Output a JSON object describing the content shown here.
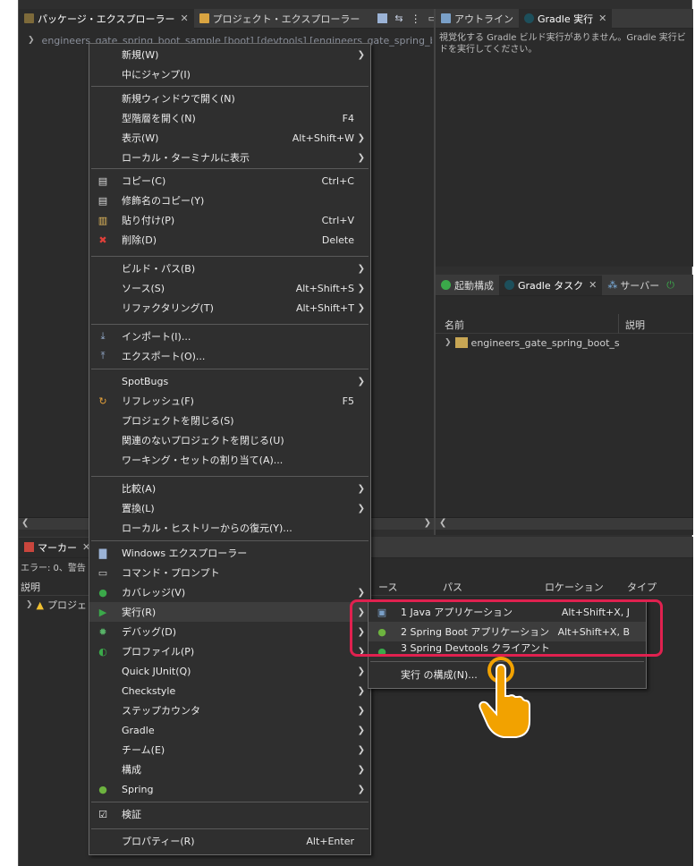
{
  "left_tabs": {
    "package_explorer": "パッケージ・エクスプローラー",
    "project_explorer": "プロジェクト・エクスプローラー"
  },
  "right_tabs": {
    "outline": "アウトライン",
    "gradle_run": "Gradle 実行"
  },
  "gradle_run_message": "視覚化する Gradle ビルド実行がありません。Gradle 実行ビドを実行してください。",
  "gradle_run_message_line1": "視覚化する Gradle ビルド実行がありません。Gradle 実行ビ",
  "gradle_run_message_line2": "ドを実行してください。",
  "project_path": "engineers_gate_spring_boot_sample [boot] [devtools] [engineers_gate_spring_bo",
  "mid_tabs": {
    "launch_config": "起動構成",
    "gradle_tasks": "Gradle タスク",
    "servers": "サーバー"
  },
  "tasks_table": {
    "col_name": "名前",
    "col_desc": "説明",
    "row1": "engineers_gate_spring_boot_s"
  },
  "markers": {
    "tab": "マーカー",
    "summary": "エラー: 0、警告",
    "col_desc": "説明",
    "row1": "プロジェ",
    "col_resource": "ース",
    "col_path": "パス",
    "col_location": "ロケーション",
    "col_type": "タイプ"
  },
  "menu_items": [
    {
      "label": "新規(W)",
      "submenu": true
    },
    {
      "label": "中にジャンプ(I)"
    },
    {
      "label": "新規ウィンドウで開く(N)"
    },
    {
      "label": "型階層を開く(N)",
      "shortcut": "F4"
    },
    {
      "label": "表示(W)",
      "shortcut": "Alt+Shift+W",
      "submenu": true
    },
    {
      "label": "ローカル・ターミナルに表示",
      "submenu": true
    },
    {
      "label": "コピー(C)",
      "shortcut": "Ctrl+C",
      "icon": "copy-icon"
    },
    {
      "label": "修飾名のコピー(Y)",
      "icon": "copy-qualified-icon"
    },
    {
      "label": "貼り付け(P)",
      "shortcut": "Ctrl+V",
      "icon": "paste-icon"
    },
    {
      "label": "削除(D)",
      "shortcut": "Delete",
      "icon": "delete-icon"
    },
    {
      "label": "ビルド・パス(B)",
      "submenu": true
    },
    {
      "label": "ソース(S)",
      "shortcut": "Alt+Shift+S",
      "submenu": true
    },
    {
      "label": "リファクタリング(T)",
      "shortcut": "Alt+Shift+T",
      "submenu": true
    },
    {
      "label": "インポート(I)...",
      "icon": "import-icon"
    },
    {
      "label": "エクスポート(O)...",
      "icon": "export-icon"
    },
    {
      "label": "SpotBugs",
      "submenu": true
    },
    {
      "label": "リフレッシュ(F)",
      "shortcut": "F5",
      "icon": "refresh-icon"
    },
    {
      "label": "プロジェクトを閉じる(S)"
    },
    {
      "label": "関連のないプロジェクトを閉じる(U)"
    },
    {
      "label": "ワーキング・セットの割り当て(A)..."
    },
    {
      "label": "比較(A)",
      "submenu": true
    },
    {
      "label": "置換(L)",
      "submenu": true
    },
    {
      "label": "ローカル・ヒストリーからの復元(Y)..."
    },
    {
      "label": "Windows エクスプローラー",
      "icon": "folder-icon"
    },
    {
      "label": "コマンド・プロンプト",
      "icon": "terminal-icon"
    },
    {
      "label": "カバレッジ(V)",
      "submenu": true,
      "icon": "coverage-icon"
    },
    {
      "label": "実行(R)",
      "submenu": true,
      "icon": "run-icon"
    },
    {
      "label": "デバッグ(D)",
      "submenu": true,
      "icon": "debug-icon"
    },
    {
      "label": "プロファイル(P)",
      "submenu": true,
      "icon": "profile-icon"
    },
    {
      "label": "Quick JUnit(Q)",
      "submenu": true
    },
    {
      "label": "Checkstyle",
      "submenu": true
    },
    {
      "label": "ステップカウンタ",
      "submenu": true
    },
    {
      "label": "Gradle",
      "submenu": true
    },
    {
      "label": "チーム(E)",
      "submenu": true
    },
    {
      "label": "構成",
      "submenu": true
    },
    {
      "label": "Spring",
      "submenu": true,
      "icon": "spring-icon"
    },
    {
      "label": "検証",
      "icon": "checkbox-icon"
    },
    {
      "label": "プロパティー(R)",
      "shortcut": "Alt+Enter"
    }
  ],
  "submenu_items": [
    {
      "label": "1 Java アプリケーション",
      "shortcut": "Alt+Shift+X, J",
      "icon": "java-app-icon"
    },
    {
      "label": "2 Spring Boot アプリケーション",
      "shortcut": "Alt+Shift+X, B",
      "icon": "spring-boot-icon"
    },
    {
      "label": "3 Spring Devtools クライアント",
      "icon": "devtools-icon"
    },
    {
      "label": "実行 の構成(N)..."
    }
  ],
  "colors": {
    "accent_callout": "#e0214f",
    "hand": "#f2a200",
    "menu_bg": "#2f2f2f"
  }
}
